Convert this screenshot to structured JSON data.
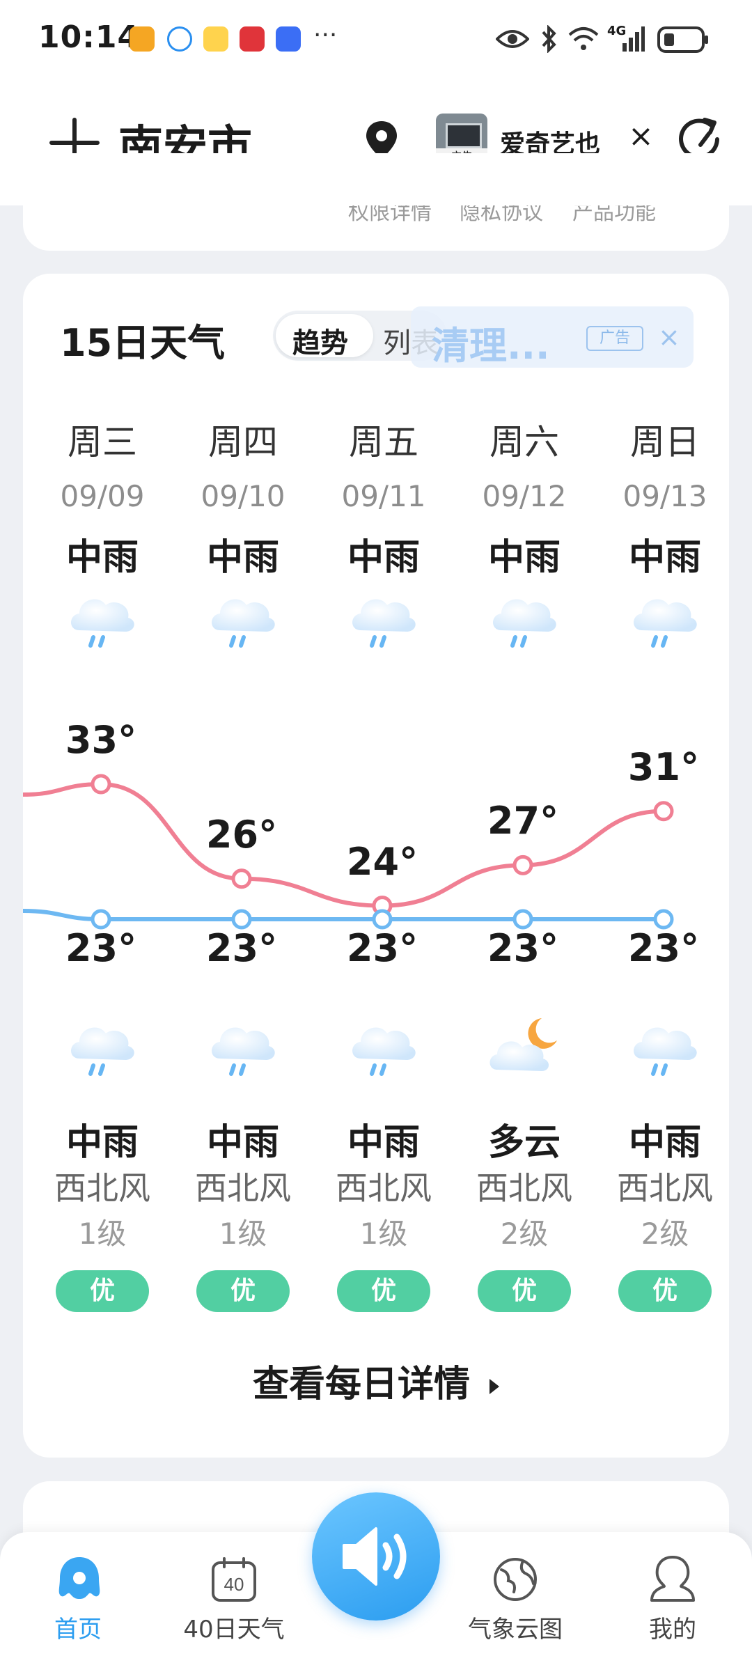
{
  "status_bar": {
    "time": "10:14",
    "dots": "···",
    "network": "4G"
  },
  "header": {
    "add_icon": "plus-icon",
    "city": "南安市...",
    "location_icon": "location-pin-icon",
    "ad_label": "广告",
    "ad_name": "爱奇艺也",
    "close": "×",
    "refresh_icon": "refresh-icon"
  },
  "top_card": {
    "links": [
      "权限详情",
      "隐私协议",
      "产品功能"
    ]
  },
  "forecast": {
    "title": "15日天气",
    "tabs": {
      "trend": "趋势",
      "list": "列表"
    },
    "ad": {
      "text": "清理...",
      "tag": "广告",
      "close": "×"
    },
    "days": [
      {
        "name": "周三",
        "date": "09/09",
        "day_cond": "中雨",
        "high": "33°",
        "low": "23°",
        "night_cond": "中雨",
        "wind": "西北风",
        "level": "1级",
        "aqi": "优",
        "day_icon": "rain-cloud-icon",
        "night_icon": "rain-cloud-icon"
      },
      {
        "name": "周四",
        "date": "09/10",
        "day_cond": "中雨",
        "high": "26°",
        "low": "23°",
        "night_cond": "中雨",
        "wind": "西北风",
        "level": "1级",
        "aqi": "优",
        "day_icon": "rain-cloud-icon",
        "night_icon": "rain-cloud-icon"
      },
      {
        "name": "周五",
        "date": "09/11",
        "day_cond": "中雨",
        "high": "24°",
        "low": "23°",
        "night_cond": "中雨",
        "wind": "西北风",
        "level": "1级",
        "aqi": "优",
        "day_icon": "rain-cloud-icon",
        "night_icon": "rain-cloud-icon"
      },
      {
        "name": "周六",
        "date": "09/12",
        "day_cond": "中雨",
        "high": "27°",
        "low": "23°",
        "night_cond": "多云",
        "wind": "西北风",
        "level": "2级",
        "aqi": "优",
        "day_icon": "rain-cloud-icon",
        "night_icon": "moon-cloud-icon"
      },
      {
        "name": "周日",
        "date": "09/13",
        "day_cond": "中雨",
        "high": "31°",
        "low": "23°",
        "night_cond": "中雨",
        "wind": "西北风",
        "level": "2级",
        "aqi": "优",
        "day_icon": "rain-cloud-icon",
        "night_icon": "rain-cloud-icon"
      }
    ],
    "high_temps": [
      33,
      26,
      24,
      27,
      31
    ],
    "low_temps": [
      23,
      23,
      23,
      23,
      23
    ],
    "colors": {
      "high_line": "#f07f93",
      "low_line": "#6db8f2",
      "aqi_good": "#52cfa2"
    },
    "more": "查看每日详情"
  },
  "bottom_nav": [
    {
      "label": "首页",
      "icon": "home-octopus-icon",
      "active": true
    },
    {
      "label": "40日天气",
      "icon": "calendar-40-icon"
    },
    {
      "label": "",
      "icon": "speaker-icon"
    },
    {
      "label": "气象云图",
      "icon": "globe-icon"
    },
    {
      "label": "我的",
      "icon": "profile-icon"
    }
  ],
  "accent_color": "#2b9df0"
}
